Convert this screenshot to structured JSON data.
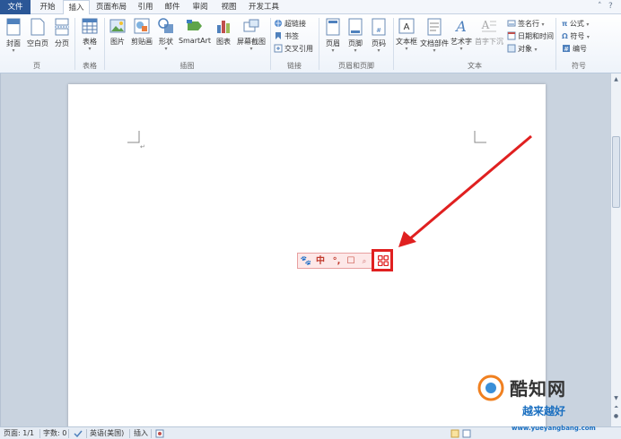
{
  "tabs": {
    "file": "文件",
    "items": [
      "开始",
      "插入",
      "页面布局",
      "引用",
      "邮件",
      "审阅",
      "视图",
      "开发工具"
    ],
    "active_index": 1
  },
  "ribbon": {
    "groups": {
      "pages": {
        "label": "页",
        "buttons": [
          "封面",
          "空白页",
          "分页"
        ]
      },
      "tables": {
        "label": "表格",
        "buttons": [
          "表格"
        ]
      },
      "illustrations": {
        "label": "插图",
        "buttons": [
          "图片",
          "剪贴画",
          "形状",
          "SmartArt",
          "图表",
          "屏幕截图"
        ]
      },
      "links": {
        "label": "链接",
        "buttons": [
          "超链接",
          "书签",
          "交叉引用"
        ]
      },
      "header_footer": {
        "label": "页眉和页脚",
        "buttons": [
          "页眉",
          "页脚",
          "页码"
        ]
      },
      "text": {
        "label": "文本",
        "buttons": [
          "文本框",
          "文档部件",
          "艺术字",
          "首字下沉"
        ],
        "small": [
          "签名行",
          "日期和时间",
          "对象"
        ]
      },
      "symbols": {
        "label": "符号",
        "small": [
          "公式",
          "符号",
          "编号"
        ]
      }
    }
  },
  "document": {
    "paragraph_mark": "↵"
  },
  "ime": {
    "items": [
      "🐾",
      "中",
      "°,",
      "☐",
      "⊞"
    ]
  },
  "statusbar": {
    "page": "页面: 1/1",
    "words": "字数: 0",
    "language": "英语(美国)",
    "mode": "插入"
  },
  "watermark": {
    "brand1": "酷知网",
    "brand2": "越来越好",
    "url": "www.yueyangbang.com"
  },
  "colors": {
    "file_tab": "#2b5797",
    "arrow": "#e02020",
    "ime_text": "#c0392b"
  }
}
